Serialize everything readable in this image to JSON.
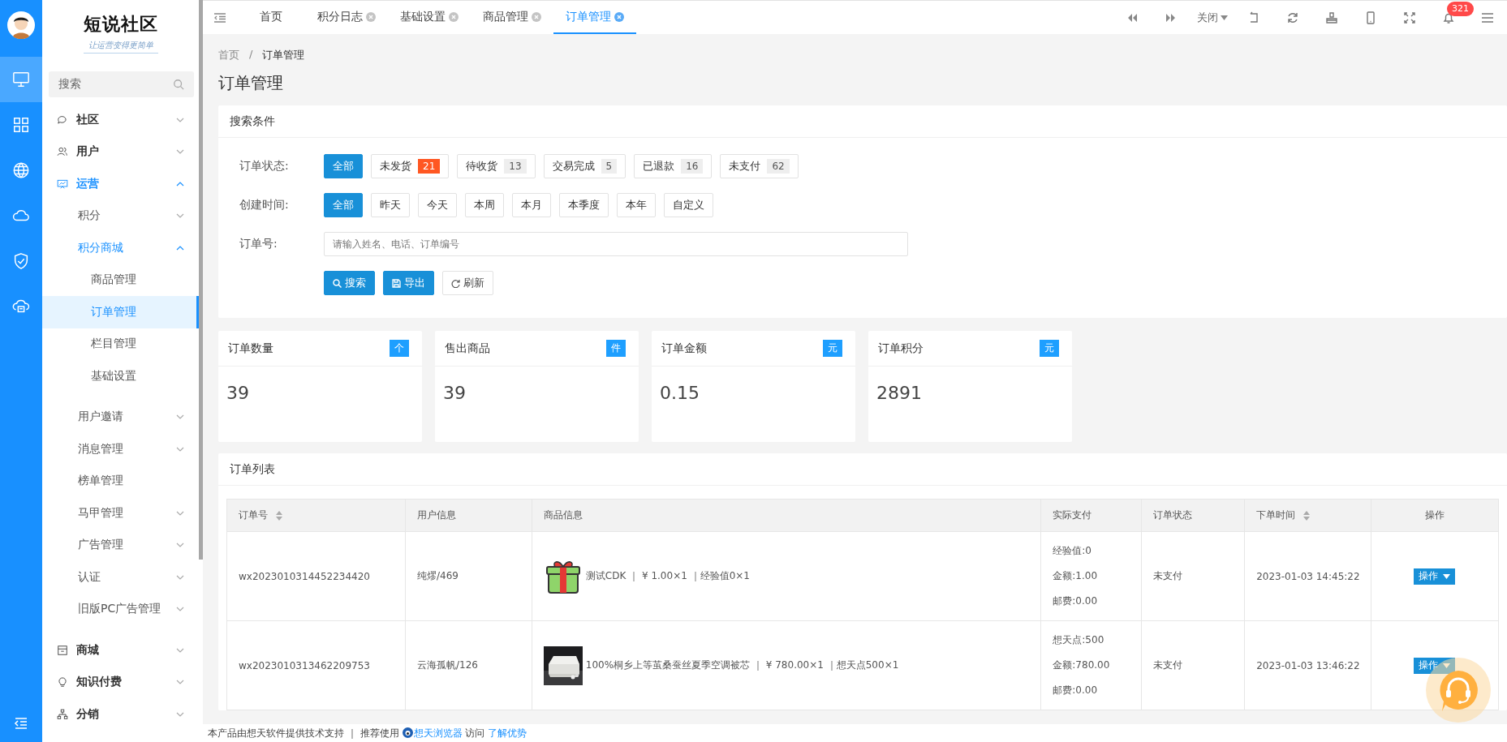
{
  "brand": {
    "name": "短说社区",
    "slogan": "让运营变得更简单"
  },
  "rail": [
    {
      "selected": true
    },
    {
      "selected": false
    },
    {
      "selected": false
    },
    {
      "selected": false
    },
    {
      "selected": false
    },
    {
      "selected": false
    }
  ],
  "sidebar": {
    "search_placeholder": "搜索",
    "items": [
      {
        "label": "社区",
        "expanded": false,
        "selected": false
      },
      {
        "label": "用户",
        "expanded": false,
        "selected": false
      },
      {
        "label": "运营",
        "expanded": true,
        "selected": false,
        "children": [
          {
            "label": "积分",
            "expanded": false,
            "selected": false
          },
          {
            "label": "积分商城",
            "expanded": true,
            "selected": false,
            "children": [
              {
                "label": "商品管理",
                "selected": false
              },
              {
                "label": "订单管理",
                "selected": true
              },
              {
                "label": "栏目管理",
                "selected": false
              },
              {
                "label": "基础设置",
                "selected": false
              }
            ]
          },
          {
            "label": "用户邀请",
            "expanded": false,
            "selected": false
          },
          {
            "label": "消息管理",
            "expanded": false,
            "selected": false
          },
          {
            "label": "榜单管理",
            "selected": false
          },
          {
            "label": "马甲管理",
            "expanded": false,
            "selected": false
          },
          {
            "label": "广告管理",
            "expanded": false,
            "selected": false
          },
          {
            "label": "认证",
            "expanded": false,
            "selected": false
          },
          {
            "label": "旧版PC广告管理",
            "expanded": false,
            "selected": false
          }
        ]
      },
      {
        "label": "商城",
        "expanded": false,
        "selected": false
      },
      {
        "label": "知识付费",
        "expanded": false,
        "selected": false
      },
      {
        "label": "分销",
        "expanded": false,
        "selected": false
      }
    ]
  },
  "tabs": [
    {
      "label": "首页",
      "closable": false,
      "selected": false
    },
    {
      "label": "积分日志",
      "closable": true,
      "selected": false
    },
    {
      "label": "基础设置",
      "closable": true,
      "selected": false
    },
    {
      "label": "商品管理",
      "closable": true,
      "selected": false
    },
    {
      "label": "订单管理",
      "closable": true,
      "selected": true
    }
  ],
  "toolbar": {
    "close_menu": "关闭",
    "notification_count": "321"
  },
  "breadcrumb": [
    "首页",
    "/",
    "订单管理"
  ],
  "page_title": "订单管理",
  "search_panel": {
    "title": "搜索条件",
    "status_label": "订单状态:",
    "statuses": [
      {
        "label": "全部",
        "selected": true
      },
      {
        "label": "未发货",
        "count": "21",
        "color": "#ff5722",
        "selected": false
      },
      {
        "label": "待收货",
        "count": "13",
        "color": "#eeeeee",
        "selected": false
      },
      {
        "label": "交易完成",
        "count": "5",
        "color": "#eeeeee",
        "selected": false
      },
      {
        "label": "已退款",
        "count": "16",
        "color": "#eeeeee",
        "selected": false
      },
      {
        "label": "未支付",
        "count": "62",
        "color": "#eeeeee",
        "selected": false
      }
    ],
    "time_label": "创建时间:",
    "times": [
      {
        "label": "全部",
        "selected": true
      },
      {
        "label": "昨天",
        "selected": false
      },
      {
        "label": "今天",
        "selected": false
      },
      {
        "label": "本周",
        "selected": false
      },
      {
        "label": "本月",
        "selected": false
      },
      {
        "label": "本季度",
        "selected": false
      },
      {
        "label": "本年",
        "selected": false
      },
      {
        "label": "自定义",
        "selected": false
      }
    ],
    "order_label": "订单号:",
    "order_placeholder": "请输入姓名、电话、订单编号",
    "buttons": [
      {
        "label": "搜索",
        "kind": "search"
      },
      {
        "label": "导出",
        "kind": "export"
      },
      {
        "label": "刷新",
        "kind": "refresh"
      }
    ]
  },
  "stats": [
    {
      "title": "订单数量",
      "unit": "个",
      "value": "39"
    },
    {
      "title": "售出商品",
      "unit": "件",
      "value": "39"
    },
    {
      "title": "订单金额",
      "unit": "元",
      "value": "0.15"
    },
    {
      "title": "订单积分",
      "unit": "元",
      "value": "2891"
    }
  ],
  "order_list": {
    "title": "订单列表",
    "columns": [
      {
        "label": "订单号",
        "sortable": true
      },
      {
        "label": "用户信息",
        "sortable": false
      },
      {
        "label": "商品信息",
        "sortable": false
      },
      {
        "label": "实际支付",
        "sortable": false
      },
      {
        "label": "订单状态",
        "sortable": false
      },
      {
        "label": "下单时间",
        "sortable": true
      },
      {
        "label": "操作",
        "sortable": false
      }
    ],
    "rows": [
      {
        "order_no": "wx2023010314452234420",
        "user": "纯熮/469",
        "kind": "icon",
        "product": "测试CDK ｜ ¥ 1.00×1 ｜经验值0×1",
        "payment": [
          "经验值:0",
          "金额:1.00",
          "邮费:0.00"
        ],
        "status": "未支付",
        "time": "2023-01-03 14:45:22",
        "action": "操作"
      },
      {
        "order_no": "wx2023010313462209753",
        "user": "云海孤帆/126",
        "kind": "picture",
        "product": "100%桐乡上等茧桑蚕丝夏季空调被芯 ｜ ¥ 780.00×1 ｜想天点500×1",
        "payment": [
          "想天点:500",
          "金额:780.00",
          "邮费:0.00"
        ],
        "status": "未支付",
        "time": "2023-01-03 13:46:22",
        "action": "操作"
      }
    ]
  },
  "footer": {
    "text": "本产品由想天软件提供技术支持 ｜ 推荐使用",
    "browser_link": "想天浏览器",
    "middle": "访问",
    "more_link": "了解优势"
  }
}
